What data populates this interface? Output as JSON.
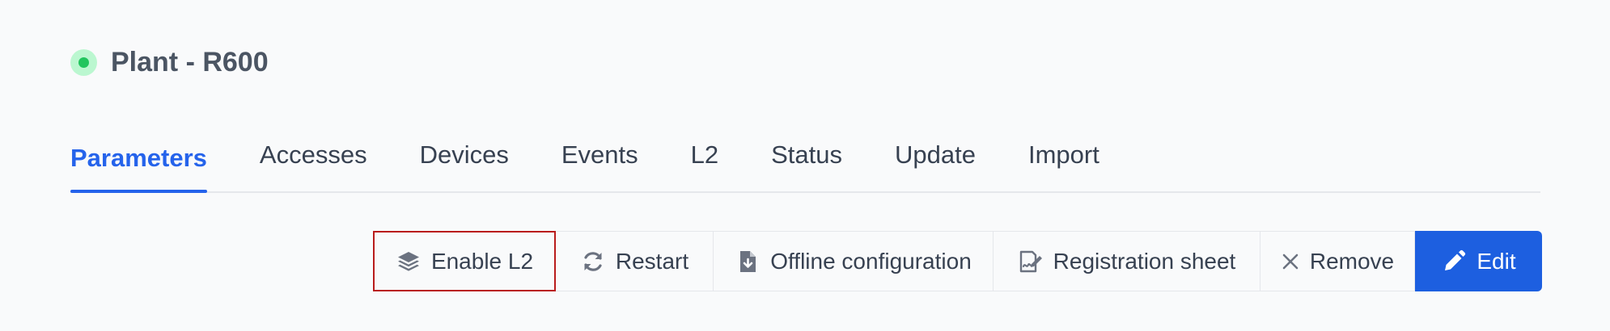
{
  "header": {
    "status_color": "#22c55e",
    "title": "Plant - R600"
  },
  "tabs": [
    {
      "label": "Parameters",
      "active": true
    },
    {
      "label": "Accesses"
    },
    {
      "label": "Devices"
    },
    {
      "label": "Events"
    },
    {
      "label": "L2"
    },
    {
      "label": "Status"
    },
    {
      "label": "Update"
    },
    {
      "label": "Import"
    }
  ],
  "toolbar": {
    "enable_l2": {
      "label": "Enable L2",
      "icon": "layers-icon"
    },
    "restart": {
      "label": "Restart",
      "icon": "refresh-icon"
    },
    "offline_config": {
      "label": "Offline configuration",
      "icon": "file-download-icon"
    },
    "registration_sheet": {
      "label": "Registration sheet",
      "icon": "signature-icon"
    },
    "remove": {
      "label": "Remove",
      "icon": "close-icon"
    },
    "edit": {
      "label": "Edit",
      "icon": "pencil-icon"
    }
  },
  "colors": {
    "accent": "#2563eb",
    "primary_button": "#1d5fe0",
    "highlight_border": "#b91c1c"
  }
}
